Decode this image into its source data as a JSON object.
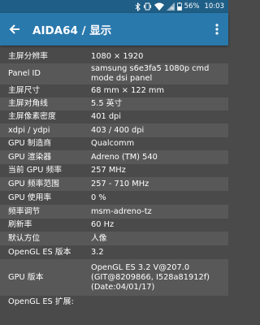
{
  "status_bar": {
    "battery": "56%",
    "time": "10:03",
    "icons": [
      "bluetooth-icon",
      "vibrate-icon",
      "wifi-icon",
      "no-sim-icon",
      "battery-icon"
    ]
  },
  "app_bar": {
    "title": "AIDA64  /  显示",
    "back_icon": "arrow-left-icon",
    "menu_icon": "more-vert-icon"
  },
  "colors": {
    "status_bar": "#1f5f87",
    "app_bar": "#2a79ad",
    "background": "#4a4a4a",
    "row_alt": "#585858"
  },
  "rows": [
    {
      "key": "主屏分辨率",
      "value": [
        "1080 × 1920"
      ]
    },
    {
      "key": "Panel ID",
      "value": [
        "samsung s6e3fa5 1080p cmd",
        "mode dsi panel"
      ]
    },
    {
      "key": "主屏尺寸",
      "value": [
        "68 mm × 122 mm"
      ]
    },
    {
      "key": "主屏对角线",
      "value": [
        "5.5 英寸"
      ]
    },
    {
      "key": "主屏像素密度",
      "value": [
        "401 dpi"
      ]
    },
    {
      "key": "xdpi / ydpi",
      "value": [
        "403 / 400 dpi"
      ]
    },
    {
      "key": "GPU 制造商",
      "value": [
        "Qualcomm"
      ]
    },
    {
      "key": "GPU 渲染器",
      "value": [
        "Adreno (TM) 540"
      ]
    },
    {
      "key": "当前 GPU 频率",
      "value": [
        "257 MHz"
      ]
    },
    {
      "key": "GPU 频率范围",
      "value": [
        "257 - 710 MHz"
      ]
    },
    {
      "key": "GPU 使用率",
      "value": [
        "0 %"
      ]
    },
    {
      "key": "频率调节",
      "value": [
        "msm-adreno-tz"
      ]
    },
    {
      "key": "刷新率",
      "value": [
        "60 Hz"
      ]
    },
    {
      "key": "默认方位",
      "value": [
        "人像"
      ]
    },
    {
      "key": "OpenGL ES 版本",
      "value": [
        "3.2"
      ]
    },
    {
      "key": "GPU 版本",
      "value": [
        "OpenGL ES 3.2 V@207.0",
        "(GIT@8209866, I528a81912f)",
        "(Date:04/01/17)"
      ]
    },
    {
      "key": "OpenGL ES 扩展:",
      "value": []
    }
  ]
}
